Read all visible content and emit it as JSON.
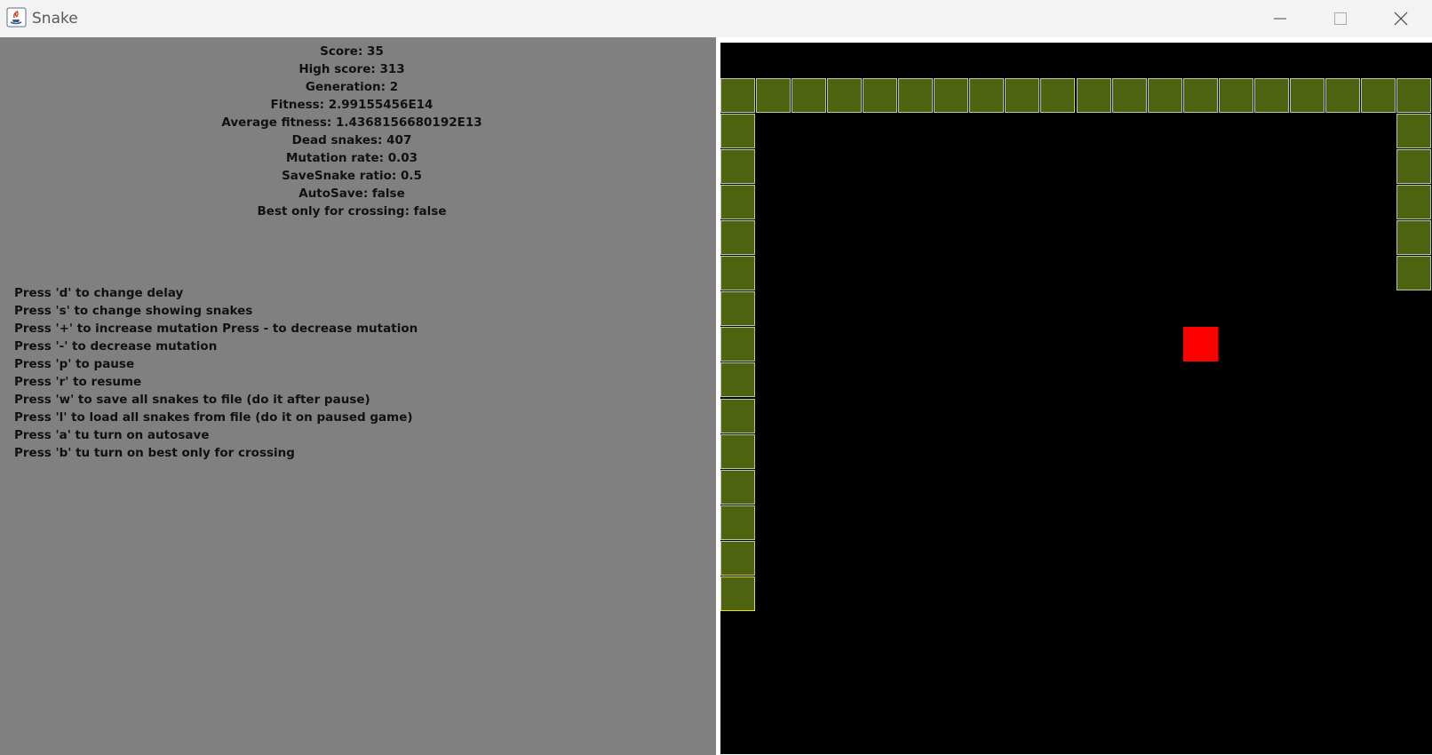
{
  "window": {
    "title": "Snake",
    "icon": "java-cup-icon",
    "controls": [
      "minimize-icon",
      "maximize-icon",
      "close-icon"
    ]
  },
  "stats": [
    "Score: 35",
    "High score: 313",
    "Generation: 2",
    "Fitness: 2.99155456E14",
    "Average fitness: 1.4368156680192E13",
    "Dead snakes: 407",
    "Mutation rate: 0.03",
    "SaveSnake ratio: 0.5",
    "AutoSave: false",
    "Best only for crossing: false"
  ],
  "controls": [
    "Press 'd' to change delay",
    "Press 's' to change showing snakes",
    "Press '+' to increase mutation Press - to decrease mutation",
    "Press '-' to decrease mutation",
    "Press 'p' to pause",
    "Press 'r' to resume",
    "Press 'w' to save all snakes to file (do it after pause)",
    "Press 'l' to load all snakes from file (do it on paused game)",
    "Press 'a' tu turn on autosave",
    "Press 'b' tu turn on best only for crossing"
  ],
  "colors": {
    "panel_bg": "#808080",
    "board_bg": "#000000",
    "snake_body": "#4f6410",
    "snake_border": "#b9c7a0",
    "snake_head_border": "#e6e600",
    "food": "#ff0000"
  },
  "game": {
    "grid": {
      "cols": 20,
      "rows": 20
    },
    "snake": {
      "head": [
        0,
        15
      ],
      "segments": [
        [
          0,
          15
        ],
        [
          0,
          14
        ],
        [
          0,
          13
        ],
        [
          0,
          12
        ],
        [
          0,
          11
        ],
        [
          0,
          10
        ],
        [
          0,
          9
        ],
        [
          0,
          8
        ],
        [
          0,
          7
        ],
        [
          0,
          6
        ],
        [
          0,
          5
        ],
        [
          0,
          4
        ],
        [
          0,
          3
        ],
        [
          0,
          2
        ],
        [
          0,
          1
        ],
        [
          1,
          1
        ],
        [
          2,
          1
        ],
        [
          3,
          1
        ],
        [
          4,
          1
        ],
        [
          5,
          1
        ],
        [
          6,
          1
        ],
        [
          7,
          1
        ],
        [
          8,
          1
        ],
        [
          9,
          1
        ],
        [
          10,
          1
        ],
        [
          11,
          1
        ],
        [
          12,
          1
        ],
        [
          13,
          1
        ],
        [
          14,
          1
        ],
        [
          15,
          1
        ],
        [
          16,
          1
        ],
        [
          17,
          1
        ],
        [
          18,
          1
        ],
        [
          19,
          1
        ],
        [
          19,
          2
        ],
        [
          19,
          3
        ],
        [
          19,
          4
        ],
        [
          19,
          5
        ],
        [
          19,
          6
        ]
      ]
    },
    "food": [
      13,
      8
    ]
  }
}
